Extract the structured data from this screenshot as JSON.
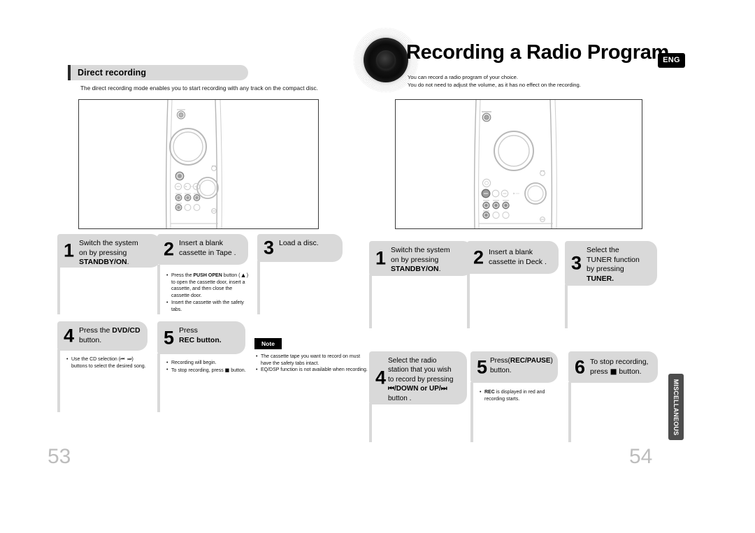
{
  "left_page": {
    "number": "53",
    "section": {
      "title": "Direct recording",
      "intro": "The direct recording mode enables you to start recording with any track on the compact disc."
    },
    "steps": [
      {
        "num": "1",
        "text_lines": [
          "Switch the system",
          "on by pressing",
          "STANDBY/ON."
        ],
        "bold_lines": [
          false,
          false,
          true
        ],
        "bullets": []
      },
      {
        "num": "2",
        "text_lines": [
          "Insert a blank",
          "cassette in Tape ."
        ],
        "bold_lines": [
          false,
          false
        ],
        "bullets": [
          "Press the PUSH OPEN button ( ⏏ ) to open the cassette door, insert a cassette, and then close the cassette door.",
          "Insert the cassette with the safety tabs."
        ]
      },
      {
        "num": "3",
        "text_lines": [
          "Load a disc."
        ],
        "bold_lines": [
          false
        ],
        "bullets": []
      },
      {
        "num": "4",
        "text_lines": [
          "Press the DVD/CD",
          "button."
        ],
        "bold_lines": [
          false,
          false
        ],
        "bullets": [
          "Use the CD selection ( ⏮⏭ ) buttons to select the desired song."
        ]
      },
      {
        "num": "5",
        "text_lines": [
          "Press",
          "REC button."
        ],
        "bold_lines": [
          false,
          true
        ],
        "bullets": [
          "Recording will begin.",
          "To stop recording, press ■ button."
        ]
      }
    ],
    "note": {
      "label": "Note",
      "bullets": [
        "The cassette tape you want to record on must have the safety tabs intact.",
        "EQ/DSP function is not available when recording."
      ]
    }
  },
  "right_page": {
    "number": "54",
    "title": "Recording a Radio Program",
    "language_badge": "ENG",
    "description_lines": [
      "You can record a radio program of your choice.",
      "You do not need to adjust the volume, as it has no effect on the recording."
    ],
    "steps": [
      {
        "num": "1",
        "text_lines": [
          "Switch the system",
          "on by pressing",
          "STANDBY/ON."
        ],
        "bold_lines": [
          false,
          false,
          true
        ],
        "bullets": []
      },
      {
        "num": "2",
        "text_lines": [
          "Insert a blank",
          "cassette in Deck ."
        ],
        "bold_lines": [
          false,
          false
        ],
        "bullets": []
      },
      {
        "num": "3",
        "text_lines": [
          "Select the",
          "TUNER function",
          "by pressing",
          "TUNER."
        ],
        "bold_lines": [
          false,
          false,
          false,
          true
        ],
        "bullets": []
      },
      {
        "num": "4",
        "text_lines": [
          "Select the radio",
          "station that you wish",
          "to record by pressing",
          "⏮/DOWN or UP/⏭",
          "button ."
        ],
        "bold_lines": [
          false,
          false,
          false,
          true,
          false
        ],
        "bullets": []
      },
      {
        "num": "5",
        "text_lines": [
          "Press(REC/PAUSE)",
          "button."
        ],
        "bold_lines": [
          false,
          false
        ],
        "bullets": [
          "REC is displayed in red and recording starts."
        ]
      },
      {
        "num": "6",
        "text_lines": [
          "To stop recording,",
          "press ■ button."
        ],
        "bold_lines": [
          false,
          false
        ],
        "bullets": []
      }
    ],
    "side_tab": "MISCELLANEOUS"
  },
  "colors": {
    "step_gray": "#d9d9d9",
    "tab_gray": "#4d4d4d",
    "page_number": "#bdbdbd",
    "badge_black": "#000000"
  },
  "device_illustration": {
    "name": "stereo-system-front-panel",
    "caption": ""
  }
}
